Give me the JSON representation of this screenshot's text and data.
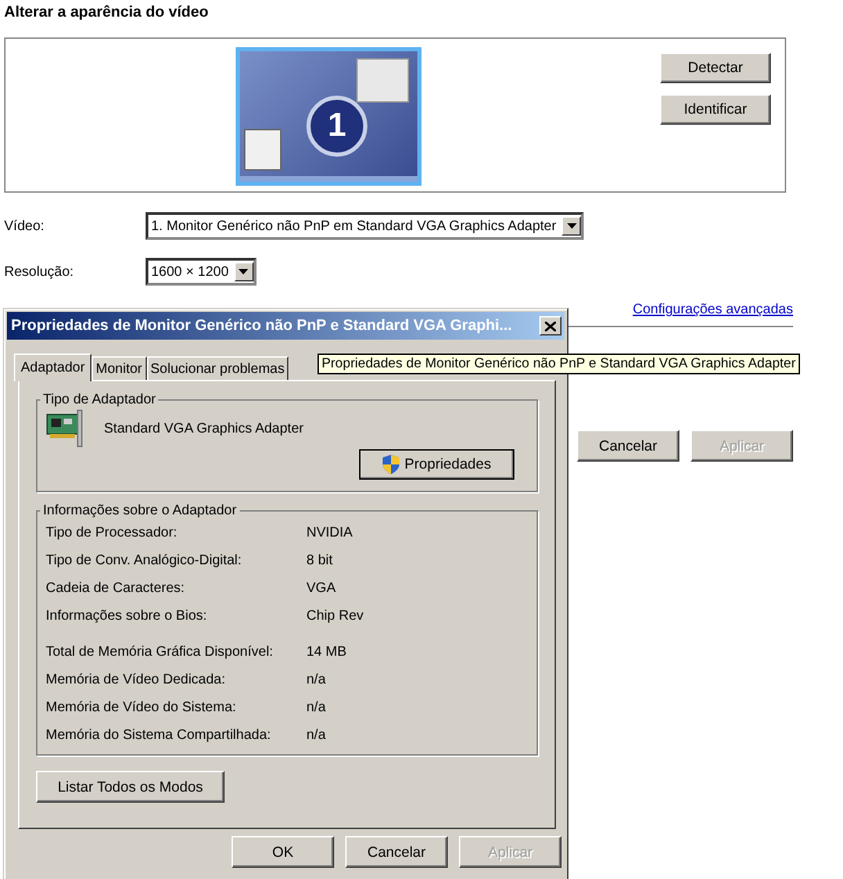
{
  "page": {
    "title": "Alterar a aparência do vídeo",
    "monitor_number": "1",
    "side_buttons": [
      {
        "label": "Detectar",
        "disabled": false
      },
      {
        "label": "Identificar",
        "disabled": false
      }
    ],
    "fields": [
      {
        "label": "Vídeo:",
        "value": "1. Monitor Genérico não PnP em Standard VGA Graphics Adapter"
      },
      {
        "label": "Resolução:",
        "value": "1600 × 1200"
      }
    ],
    "advanced_link": "Configurações avançadas",
    "footer_buttons": [
      {
        "label": "Cancelar",
        "disabled": false
      },
      {
        "label": "Aplicar",
        "disabled": true
      }
    ]
  },
  "dialog": {
    "title": "Propriedades de Monitor Genérico não PnP e Standard VGA Graphi...",
    "tabs": [
      {
        "label": "Adaptador",
        "selected": true
      },
      {
        "label": "Monitor",
        "selected": false
      },
      {
        "label": "Solucionar problemas",
        "selected": false
      }
    ],
    "adapter_type": {
      "legend": "Tipo de Adaptador",
      "name": "Standard VGA Graphics Adapter",
      "button": "Propriedades"
    },
    "adapter_info": {
      "legend": "Informações sobre o Adaptador",
      "groups": [
        [
          {
            "label": "Tipo de Processador:",
            "value": "NVIDIA"
          },
          {
            "label": "Tipo de Conv. Analógico-Digital:",
            "value": "8 bit"
          },
          {
            "label": "Cadeia de Caracteres:",
            "value": "VGA"
          },
          {
            "label": "Informações sobre o Bios:",
            "value": "Chip Rev"
          }
        ],
        [
          {
            "label": "Total de Memória Gráfica Disponível:",
            "value": "14 MB"
          },
          {
            "label": "Memória de Vídeo Dedicada:",
            "value": "n/a"
          },
          {
            "label": "Memória de Vídeo do Sistema:",
            "value": "n/a"
          },
          {
            "label": "Memória do Sistema Compartilhada:",
            "value": "n/a"
          }
        ]
      ]
    },
    "list_modes_button": "Listar Todos os Modos",
    "buttons": [
      {
        "label": "OK",
        "disabled": false
      },
      {
        "label": "Cancelar",
        "disabled": false
      },
      {
        "label": "Aplicar",
        "disabled": true
      }
    ]
  },
  "tooltip": "Propriedades de Monitor Genérico não PnP e Standard VGA Graphics Adapter"
}
